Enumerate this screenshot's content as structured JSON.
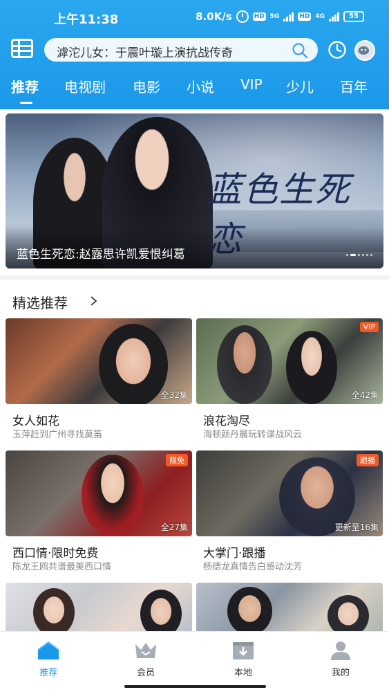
{
  "statusbar": {
    "time": "上午11:38",
    "speed": "8.0K/s",
    "hd1": "HD",
    "net1": "5G",
    "hd2": "HD",
    "net2": "4G",
    "battery": "55"
  },
  "header": {
    "search_text": "滹沱儿女：于震叶璇上演抗战传奇",
    "tabs": [
      "推荐",
      "电视剧",
      "电影",
      "小说",
      "VIP",
      "少儿",
      "百年"
    ],
    "active_tab": 0,
    "accent_color": "#1c98ea"
  },
  "banner": {
    "title_art": "蓝色生死恋",
    "caption": "蓝色生死恋:赵露思许凯爱恨纠葛",
    "slide_count": 6,
    "active_slide": 1
  },
  "section": {
    "title": "精选推荐"
  },
  "cards": [
    {
      "title": "女人如花",
      "subtitle": "玉萍赶到广州寻找莫笛",
      "episodes": "全32集",
      "badge": ""
    },
    {
      "title": "浪花淘尽",
      "subtitle": "海顿颜丹晨玩转谍战风云",
      "episodes": "全42集",
      "badge": "VIP"
    },
    {
      "title": "西口情·限时免费",
      "subtitle": "陈龙王鸥共谱最美西口情",
      "episodes": "全27集",
      "badge": "限免"
    },
    {
      "title": "大掌门·跟播",
      "subtitle": "杨德龙真情告白感动沈芳",
      "episodes": "更新至16集",
      "badge": "跟播"
    }
  ],
  "bottom_nav": {
    "items": [
      "推荐",
      "会员",
      "本地",
      "我的"
    ],
    "active": 0
  },
  "icons": [
    "menu-icon",
    "search-icon",
    "history-icon",
    "avatar",
    "home-icon",
    "crown-icon",
    "download-icon",
    "user-icon"
  ]
}
